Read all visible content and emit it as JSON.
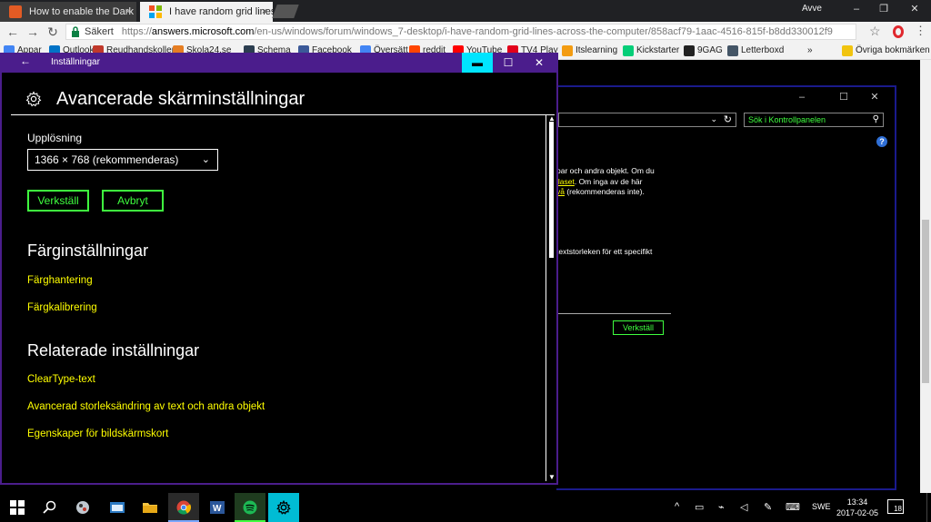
{
  "browser": {
    "tabs": [
      {
        "title": "How to enable the Dark",
        "active": false,
        "close": "×"
      },
      {
        "title": "I have random grid lines",
        "active": true,
        "close": "×"
      }
    ],
    "window_user": "Avve",
    "window_controls": {
      "minimize": "–",
      "maximize": "❐",
      "close": "✕"
    },
    "nav": {
      "back": "←",
      "forward": "→",
      "reload": "↻"
    },
    "address": {
      "secure_label": "Säkert",
      "url_prefix": "https://",
      "url_host": "answers.microsoft.com",
      "url_path": "/en-us/windows/forum/windows_7-desktop/i-have-random-grid-lines-across-the-computer/858acf79-1aac-4516-815f-b8dd330012f9"
    },
    "star_icon": "☆",
    "menu_icon": "⋮",
    "bookmarks": [
      {
        "label": "Appar",
        "color": "#4285f4"
      },
      {
        "label": "Outlook",
        "color": "#0072c6"
      },
      {
        "label": "Reudhandskollen",
        "color": "#c0392b"
      },
      {
        "label": "Skola24.se",
        "color": "#e67e22"
      },
      {
        "label": "Schema",
        "color": "#2c3e50"
      },
      {
        "label": "Facebook",
        "color": "#3b5998"
      },
      {
        "label": "Översätt",
        "color": "#4285f4"
      },
      {
        "label": "reddit",
        "color": "#ff4500"
      },
      {
        "label": "YouTube",
        "color": "#ff0000"
      },
      {
        "label": "TV4 Play",
        "color": "#e2001a"
      },
      {
        "label": "Itslearning",
        "color": "#f39c12"
      },
      {
        "label": "Kickstarter",
        "color": "#05ce78"
      },
      {
        "label": "9GAG",
        "color": "#222222"
      },
      {
        "label": "Letterboxd",
        "color": "#445566"
      }
    ],
    "bookmarks_more": "»",
    "other_bookmarks": "Övriga bokmärken"
  },
  "control_panel": {
    "controls": {
      "minimize": "–",
      "maximize": "☐",
      "close": "✕"
    },
    "address_dropdown": "⌄",
    "refresh": "↻",
    "search_placeholder": "Sök i Kontrollpanelen",
    "search_icon": "⚲",
    "help": "?",
    "text_line1": "par och andra objekt. Om du",
    "text_link1": "ilaset",
    "text_line2": ". Om inga av de här",
    "text_link2": "vå",
    "text_line3": " (rekommenderas inte).",
    "text_line4": "textstorleken för ett specifikt",
    "apply_label": "Verkställ"
  },
  "settings": {
    "app_title": "Inställningar",
    "back": "←",
    "controls": {
      "minimize": "▬",
      "maximize": "☐",
      "close": "✕"
    },
    "page_title": "Avancerade skärminställningar",
    "resolution_label": "Upplösning",
    "resolution_value": "1366 × 768 (rekommenderas)",
    "chevron": "⌄",
    "apply_label": "Verkställ",
    "cancel_label": "Avbryt",
    "color_section": "Färginställningar",
    "color_links": [
      "Färghantering",
      "Färgkalibrering"
    ],
    "related_section": "Relaterade inställningar",
    "related_links": [
      "ClearType-text",
      "Avancerad storleksändring av text och andra objekt",
      "Egenskaper för bildskärmskort"
    ],
    "scroll_up": "▲",
    "scroll_down": "▼"
  },
  "taskbar": {
    "language": "SWE",
    "time": "13:34",
    "date": "2017-02-05",
    "notifications": "18",
    "tray_icons": {
      "chevron": "^",
      "battery": "▭",
      "network": "⌁",
      "volume": "◁",
      "pen": "✎",
      "keyboard": "⌨"
    }
  }
}
